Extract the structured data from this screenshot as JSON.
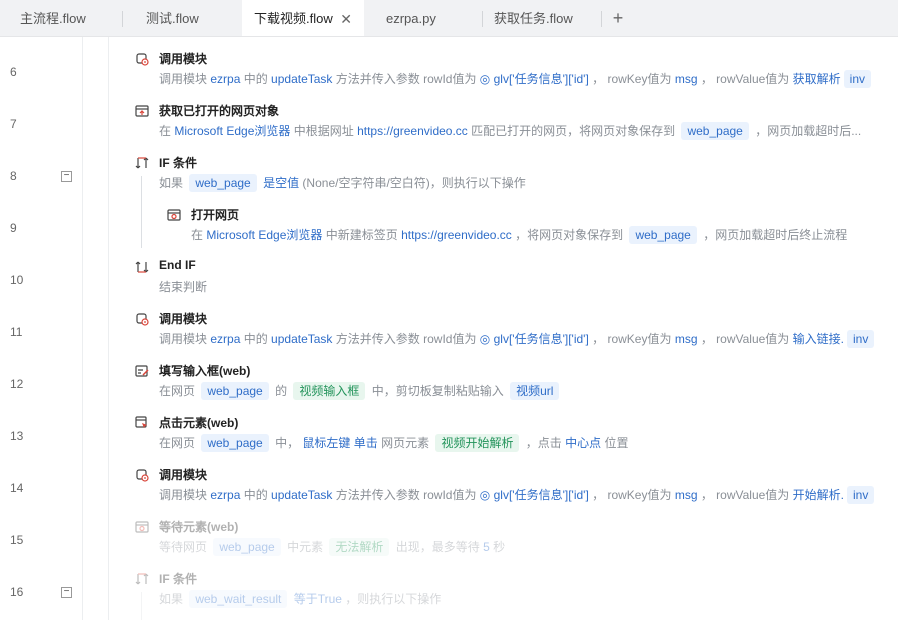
{
  "tabs": [
    {
      "label": "主流程.flow",
      "active": false,
      "closable": false
    },
    {
      "label": "测试.flow",
      "active": false,
      "closable": false
    },
    {
      "label": "下载视频.flow",
      "active": true,
      "closable": true
    },
    {
      "label": "ezrpa.py",
      "active": false,
      "closable": false
    },
    {
      "label": "获取任务.flow",
      "active": false,
      "closable": false
    }
  ],
  "add_tab_label": "+",
  "close_label": "✕",
  "fold_label": "−",
  "lines": [
    "6",
    "7",
    "8",
    "9",
    "10",
    "11",
    "12",
    "13",
    "14",
    "15",
    "16"
  ],
  "steps": [
    {
      "title": "调用模块",
      "d": [
        "调用模块 ",
        "ezrpa",
        " 中的 ",
        "updateTask",
        " 方法并传入参数 rowId值为 ",
        "◎ glv['任务信息']['id']",
        " ，  rowKey值为 ",
        "msg",
        "  ，  rowValue值为 ",
        "获取解析",
        " inv"
      ]
    },
    {
      "title": "获取已打开的网页对象",
      "d": [
        "在 ",
        "Microsoft Edge浏览器",
        " 中根据网址 ",
        "https://greenvideo.cc",
        " 匹配已打开的网页，将网页对象保存到 ",
        "web_page",
        " ，网页加载超时后..."
      ]
    },
    {
      "title": "IF 条件",
      "d": [
        "如果 ",
        "web_page",
        " ",
        "是空值",
        " (None/空字符串/空白符)，则执行以下操作"
      ]
    },
    {
      "title": "打开网页",
      "d": [
        "在 ",
        "Microsoft Edge浏览器",
        " 中新建标签页 ",
        "https://greenvideo.cc",
        " ，将网页对象保存到 ",
        "web_page",
        " ，网页加载超时后终止流程"
      ]
    },
    {
      "title": "End IF",
      "d": [
        "结束判断"
      ]
    },
    {
      "title": "调用模块",
      "d": [
        "调用模块 ",
        "ezrpa",
        " 中的 ",
        "updateTask",
        " 方法并传入参数 rowId值为 ",
        "◎ glv['任务信息']['id']",
        " ，  rowKey值为 ",
        "msg",
        "  ，  rowValue值为 ",
        "输入链接.",
        " inv"
      ]
    },
    {
      "title": "填写输入框(web)",
      "d": [
        "在网页 ",
        "web_page",
        " 的 ",
        "视频输入框",
        " 中，剪切板复制粘贴输入 ",
        "视频url"
      ]
    },
    {
      "title": "点击元素(web)",
      "d": [
        "在网页 ",
        "web_page",
        " 中，  ",
        "鼠标左键",
        " ",
        "单击",
        " 网页元素 ",
        "视频开始解析",
        " ，点击 ",
        "中心点",
        " 位置"
      ]
    },
    {
      "title": "调用模块",
      "d": [
        "调用模块 ",
        "ezrpa",
        " 中的 ",
        "updateTask",
        " 方法并传入参数 rowId值为 ",
        "◎ glv['任务信息']['id']",
        " ，  rowKey值为 ",
        "msg",
        "  ，  rowValue值为 ",
        "开始解析.",
        " inv"
      ]
    },
    {
      "title": "等待元素(web)",
      "d": [
        "等待网页 ",
        "web_page",
        " 中元素 ",
        "无法解析",
        " 出现，最多等待 ",
        "5",
        " 秒"
      ]
    },
    {
      "title": "IF 条件",
      "d": [
        "如果 ",
        "web_wait_result",
        " ",
        "等于True",
        " ，则执行以下操作"
      ]
    }
  ],
  "icons": [
    "module-icon",
    "browser-icon",
    "if-icon",
    "open-page-icon",
    "end-if-icon",
    "module-icon",
    "input-icon",
    "click-icon",
    "module-icon",
    "wait-icon",
    "if-icon"
  ],
  "colors": {
    "keyword": "#2f6dc8",
    "chip_bg": "#eaf2fd",
    "green": "#22935a",
    "icon_red": "#d9453a"
  }
}
